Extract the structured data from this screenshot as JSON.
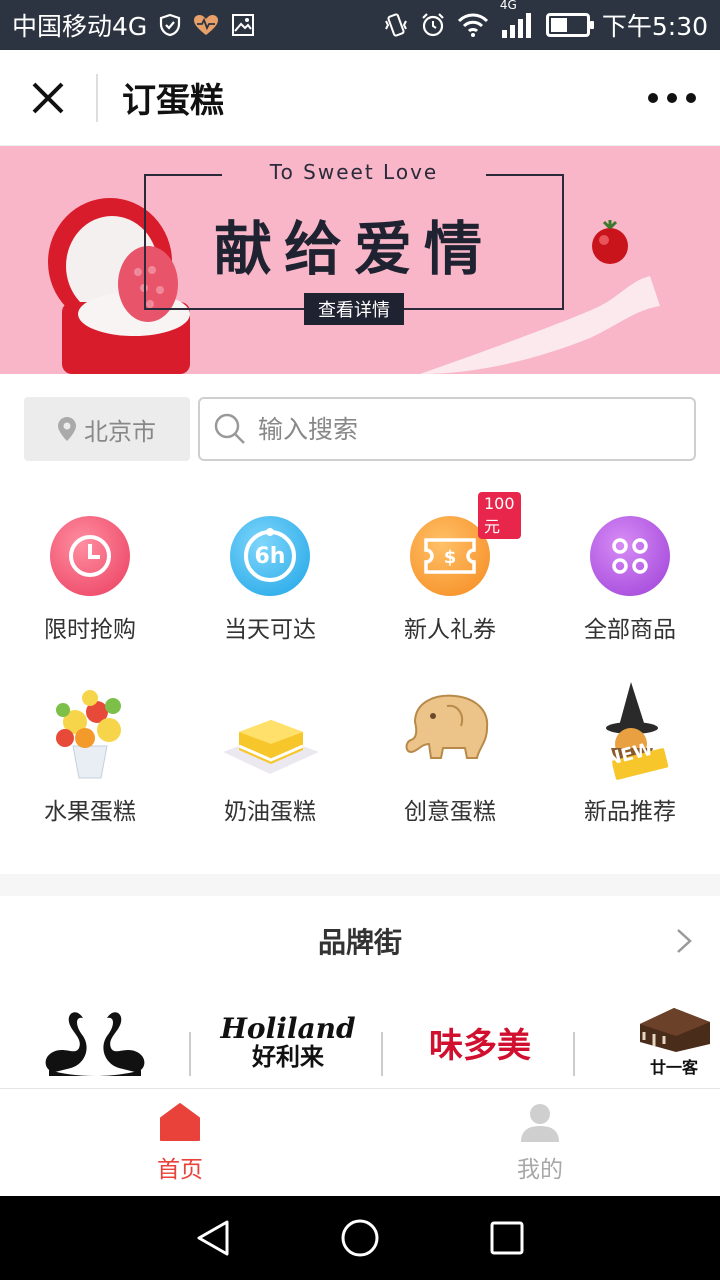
{
  "status_bar": {
    "carrier": "中国移动4G",
    "network": "4G",
    "time": "下午5:30"
  },
  "title_bar": {
    "title": "订蛋糕"
  },
  "banner": {
    "subtitle": "To Sweet Love",
    "title": "献给爱情",
    "button": "查看详情"
  },
  "search": {
    "city": "北京市",
    "placeholder": "输入搜索"
  },
  "categories": [
    {
      "label": "限时抢购",
      "icon": "clock-icon",
      "color": "#f0536f"
    },
    {
      "label": "当天可达",
      "icon": "6h-icon",
      "color": "#34b5ee",
      "icon_text": "6h"
    },
    {
      "label": "新人礼券",
      "icon": "coupon-icon",
      "color": "#f7922b",
      "badge": "100元"
    },
    {
      "label": "全部商品",
      "icon": "all-products-icon",
      "color": "#b04fe0"
    },
    {
      "label": "水果蛋糕",
      "icon": "fruit-cake-image"
    },
    {
      "label": "奶油蛋糕",
      "icon": "cream-cake-image"
    },
    {
      "label": "创意蛋糕",
      "icon": "elephant-cookie-image"
    },
    {
      "label": "新品推荐",
      "icon": "new-product-image",
      "badge": "NEW"
    }
  ],
  "brand_street": {
    "title": "品牌街",
    "brands": [
      {
        "name": "black-swan"
      },
      {
        "name": "Holiland",
        "en": "Holiland",
        "cn": "好利来"
      },
      {
        "name": "味多美",
        "cn": "味多美"
      },
      {
        "name": "21cake",
        "cn": "廿一客"
      }
    ]
  },
  "tab_bar": {
    "tabs": [
      {
        "label": "首页",
        "active": true
      },
      {
        "label": "我的",
        "active": false
      }
    ]
  },
  "colors": {
    "accent": "#e8423a",
    "banner_bg": "#f8b6c8",
    "status_bar": "#2d3441"
  }
}
